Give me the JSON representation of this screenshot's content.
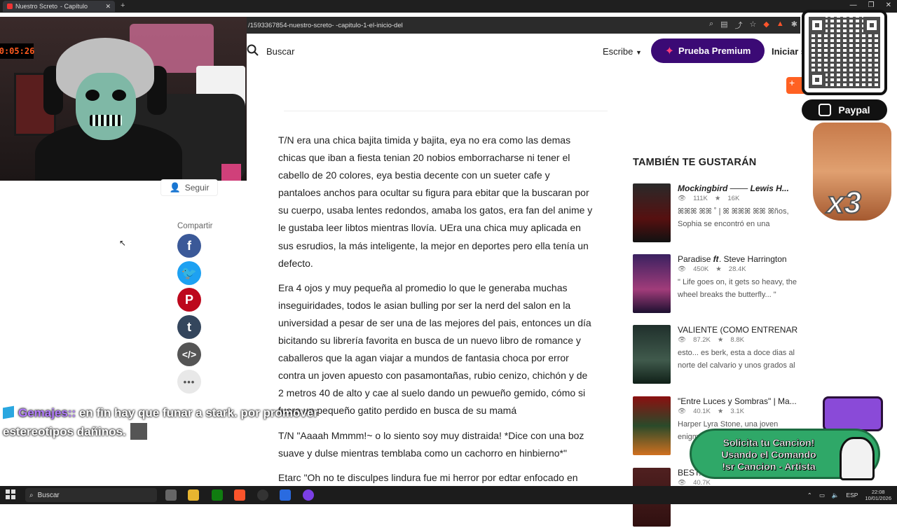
{
  "browser": {
    "tab_title": "Nuestro Screto ",
    "tab_title_suffix": " - Capítulo",
    "url": "/1593367854-nuestro-screto- -capitulo-1-el-inicio-del"
  },
  "header": {
    "search_label": "Buscar",
    "write_label": "Escribe",
    "premium_label": "Prueba Premium",
    "login_label": "Iniciar s"
  },
  "webcam": {
    "timer": "0:05:26"
  },
  "author_panel": {
    "follow_label": "Seguir",
    "share_label": "Compartir"
  },
  "story": {
    "paragraphs": [
      "T/N era una chica bajita timida y bajita, eya no era como las demas chicas que iban a fiesta tenian 20 nobios emborracharse ni tener el cabello de 20 colores, eya bestia decente con un sueter cafe y pantaloes anchos para ocultar su figura para ebitar que la buscaran por su cuerpo, usaba lentes redondos, amaba los gatos, era fan del anime y le gustaba leer libtos mientras llovía. UEra una chica muy aplicada en sus esrudios, la más inteligente, la mejor en deportes pero ella tenía un defecto.",
      "Era 4 ojos y muy pequeña al promedio lo que le generaba muchas inseguiridades, todos le asian bulling por ser la nerd del salon en la universidad a pesar de ser una de las mejores del pais, entonces un día bicitando su librería favorita en busca de un nuevo libro de romance y caballeros que la agan viajar a mundos de fantasia choca por error contra un joven apuesto con pasamontañas, rubio cenizo, chichón y de 2 metros 40 de alto y cae al suelo dando un pewueño gemido, cómo si fuera un pequeño gatito perdido en busca de su mamá",
      "T/N \"Aaaah Mmmm!~ o lo siento soy muy distraida! *Dice con una boz suave y dulse mientras temblaba como un cachorro en hinbierno*\"",
      "Etarc \"Oh no te disculpes lindura fue mi herror por edtar enfocado en mis pensamientos jajaja, ven dejame ayudarte *Extiende su enorme"
    ]
  },
  "recommendations": {
    "heading": "TAMBIÉN TE GUSTARÁN",
    "items": [
      {
        "title": "Mockingbird ─── Lewis H...",
        "reads": "111K",
        "votes": "16K",
        "desc": "ꕤꕤꕤ ꕤꕤ ˚ | ꕤ ꕤꕤꕤ ꕤꕤ ꕤños, Sophia se encontró en una"
      },
      {
        "title": "Paradise 𝒇𝒕. Steve Harrington",
        "reads": "450K",
        "votes": "28.4K",
        "desc": "\" Life goes on, it gets so heavy, the wheel breaks the butterfly... \""
      },
      {
        "title": "VALIENTE (COMO ENTRENAR ...",
        "reads": "87.2K",
        "votes": "8.8K",
        "desc": "esto... es berk, esta a doce dias al norte del calvario y unos grados al"
      },
      {
        "title": "\"Entre Luces y Sombras\" | Ma...",
        "reads": "40.1K",
        "votes": "3.1K",
        "desc": "Harper Lyra Stone, una joven enigm..."
      },
      {
        "title": "BEST...",
        "reads": "40.7K",
        "votes": "",
        "desc": ""
      }
    ]
  },
  "overlay": {
    "paypal_label": "Paypal",
    "multiplier": "x3",
    "chat_user": "Gemajes::",
    "chat_message": " en fin hay que funar a stark. por promover estereotipos dañinos.",
    "request_line1": "Solicita tu Cancion!",
    "request_line2": "Usando el Comando",
    "request_line3": "!sr Cancion - Artista"
  },
  "taskbar": {
    "search_label": "Buscar",
    "lang": "ESP",
    "time": "22:08",
    "date": "10/01/2026"
  }
}
